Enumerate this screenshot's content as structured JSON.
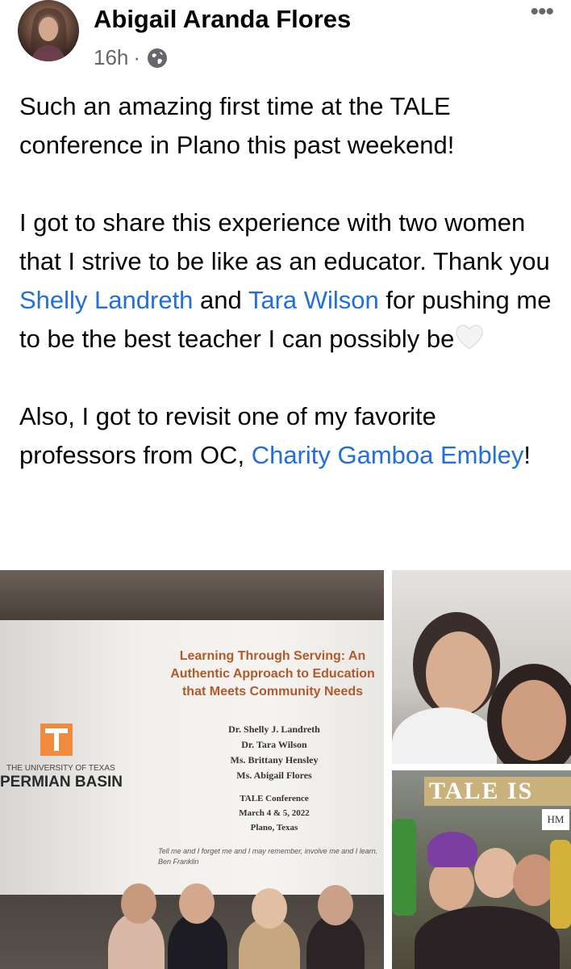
{
  "post": {
    "author": "Abigail Aranda Flores",
    "time": "16h",
    "separator": "·",
    "privacy_icon": "globe-icon",
    "more_icon": "more-horizontal-icon",
    "more_label": "•••"
  },
  "body": {
    "p1": "Such an amazing first time at the TALE conference in Plano this past weekend!",
    "p2_a": "I got to share this experience with two women that I strive to be like as an educator. Thank you ",
    "p2_link1": "Shelly Landreth",
    "p2_b": " and ",
    "p2_link2": "Tara Wilson",
    "p2_c": " for pushing me to be the best teacher I can possibly be",
    "p2_emoji": "white-heart-icon",
    "p3_a": "Also, I got to revisit one of my favorite professors from OC, ",
    "p3_link": "Charity Gamboa Embley",
    "p3_b": "!"
  },
  "photos": {
    "main": {
      "utpb_small": "THE UNIVERSITY OF TEXAS",
      "utpb_big": "PERMIAN BASIN",
      "slide_title": "Learning Through Serving: An Authentic Approach to Education that Meets Community Needs",
      "names": [
        "Dr. Shelly J. Landreth",
        "Dr. Tara Wilson",
        "Ms. Brittany Hensley",
        "Ms. Abigail Flores"
      ],
      "conf": [
        "TALE Conference",
        "March 4 & 5, 2022",
        "Plano, Texas"
      ],
      "quote": "Tell me and I forget me and I may remember, involve me and I learn. Ben Franklin"
    },
    "bottom_right": {
      "sign": "TALE IS",
      "badge": "HM"
    }
  },
  "colors": {
    "link": "#216fdb",
    "meta": "#65676b",
    "text": "#050505"
  }
}
